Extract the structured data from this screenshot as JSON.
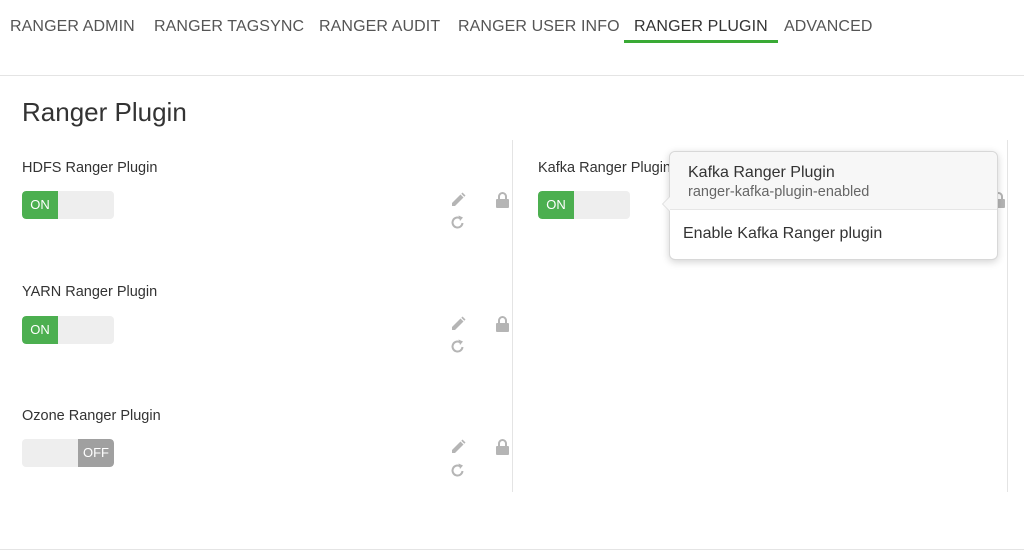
{
  "tabs": [
    {
      "label": "RANGER ADMIN",
      "active": false
    },
    {
      "label": "RANGER TAGSYNC",
      "active": false
    },
    {
      "label": "RANGER AUDIT",
      "active": false
    },
    {
      "label": "RANGER USER INFO",
      "active": false
    },
    {
      "label": "RANGER PLUGIN",
      "active": true
    },
    {
      "label": "ADVANCED",
      "active": false
    }
  ],
  "page_title": "Ranger Plugin",
  "plugins": [
    {
      "label": "HDFS Ranger Plugin",
      "state": "ON"
    },
    {
      "label": "YARN Ranger Plugin",
      "state": "ON"
    },
    {
      "label": "Ozone Ranger Plugin",
      "state": "OFF"
    },
    {
      "label": "Kafka Ranger Plugin",
      "state": "ON"
    }
  ],
  "popover": {
    "title": "Kafka Ranger Plugin",
    "subtitle": "ranger-kafka-plugin-enabled",
    "body": "Enable Kafka Ranger plugin"
  },
  "colors": {
    "accent": "#3aaa35",
    "toggle_on": "#4caf50",
    "toggle_off": "#a0a0a0",
    "icon": "#b5b5b5"
  },
  "icons": {
    "edit": "pencil-icon",
    "refresh": "undo-icon",
    "lock": "lock-icon"
  }
}
